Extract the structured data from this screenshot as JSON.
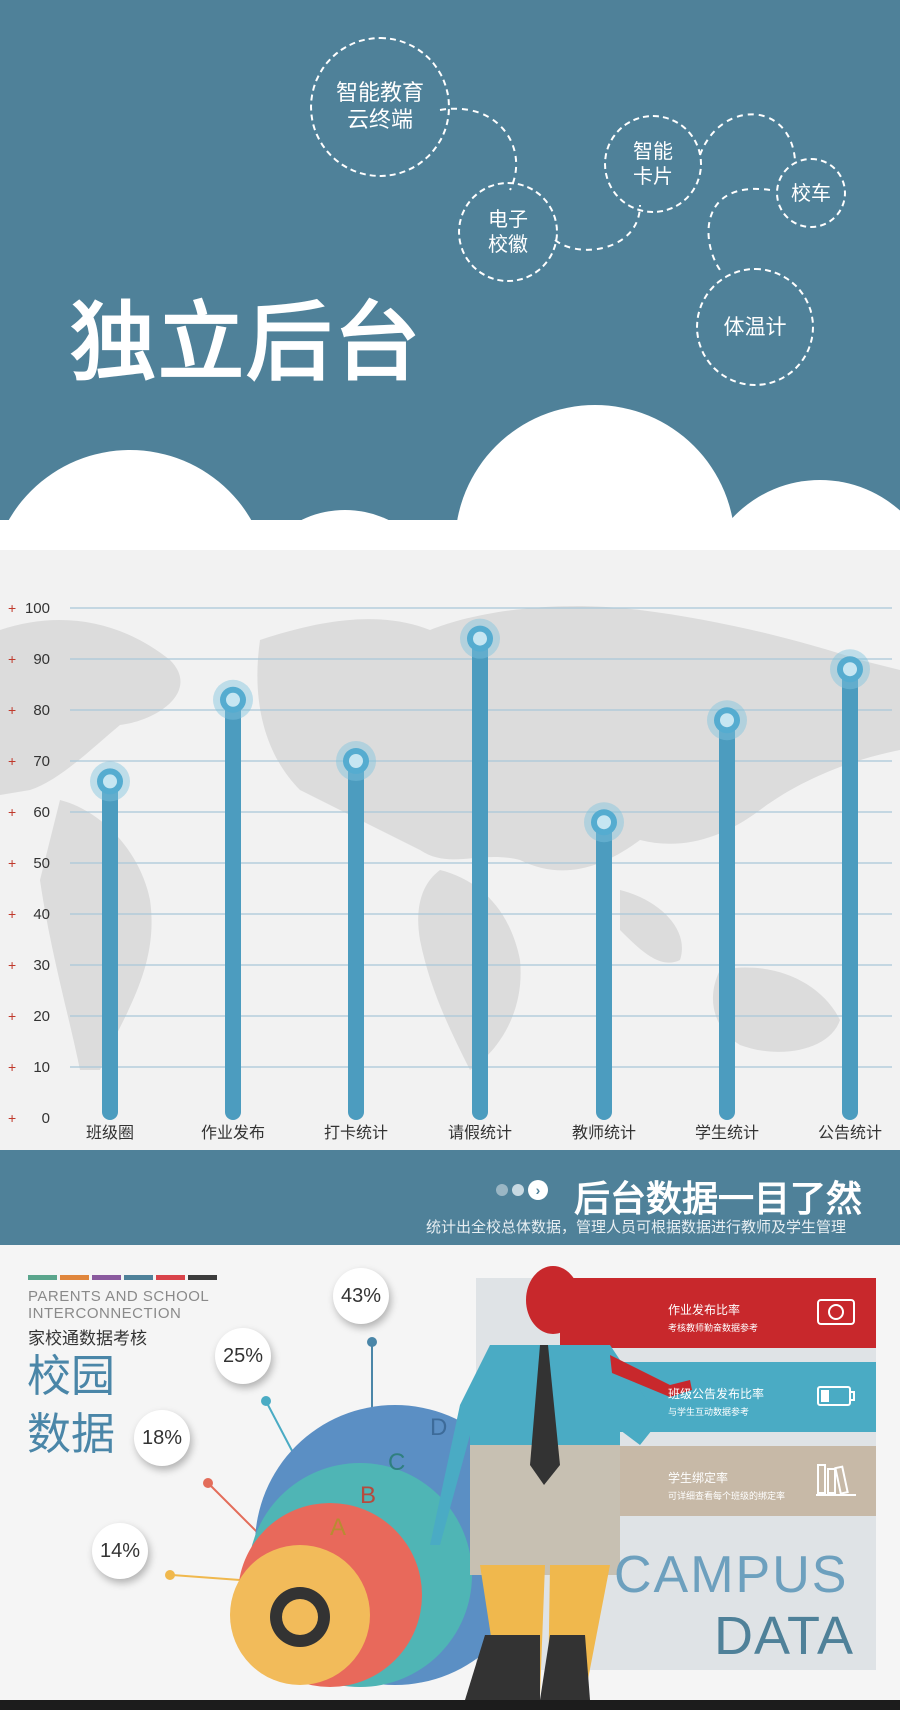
{
  "hero": {
    "title": "独立后台",
    "bubbles": [
      {
        "label": "智能教育\n云终端"
      },
      {
        "label": "电子\n校徽"
      },
      {
        "label": "智能\n卡片"
      },
      {
        "label": "校车"
      },
      {
        "label": "体温计"
      }
    ]
  },
  "chart_data": {
    "type": "bar",
    "categories": [
      "班级圈",
      "作业发布",
      "打卡统计",
      "请假统计",
      "教师统计",
      "学生统计",
      "公告统计"
    ],
    "values": [
      66,
      82,
      70,
      94,
      58,
      78,
      88
    ],
    "ylim": [
      0,
      100
    ],
    "yticks": [
      0,
      10,
      20,
      30,
      40,
      50,
      60,
      70,
      80,
      90,
      100
    ],
    "tick_prefix": "+",
    "grid": true,
    "bar_color": "#4c9cbf",
    "tick_prefix_color": "#c0392b"
  },
  "banner": {
    "headline": "后台数据一目了然",
    "subtitle": "统计出全校总体数据，管理人员可根据数据进行教师及学生管理"
  },
  "campus": {
    "en_heading": "PARENTS AND SCHOOL\nINTERCONNECTION",
    "cn_subheading": "家校通数据考核",
    "cn_title": "校园\n数据",
    "colorbar": [
      "#5aa58c",
      "#e0863c",
      "#8a5a9e",
      "#4f8199",
      "#d9434a",
      "#3c3c3c"
    ],
    "percentages": [
      "43%",
      "25%",
      "18%",
      "14%"
    ],
    "circle_letters": [
      "D",
      "C",
      "B",
      "A"
    ],
    "panels": [
      {
        "title": "作业发布比率",
        "desc": "考核教师勤奋数据参考",
        "icon": "camera-icon",
        "color": "#c8282c"
      },
      {
        "title": "班级公告发布比率",
        "desc": "与学生互动数据参考",
        "icon": "battery-icon",
        "color": "#4aabc4"
      },
      {
        "title": "学生绑定率",
        "desc": "可详细查看每个班级的绑定率",
        "icon": "books-icon",
        "color": "#c7b9a7"
      }
    ],
    "campus_word": "CAMPUS",
    "data_word": "DATA"
  }
}
